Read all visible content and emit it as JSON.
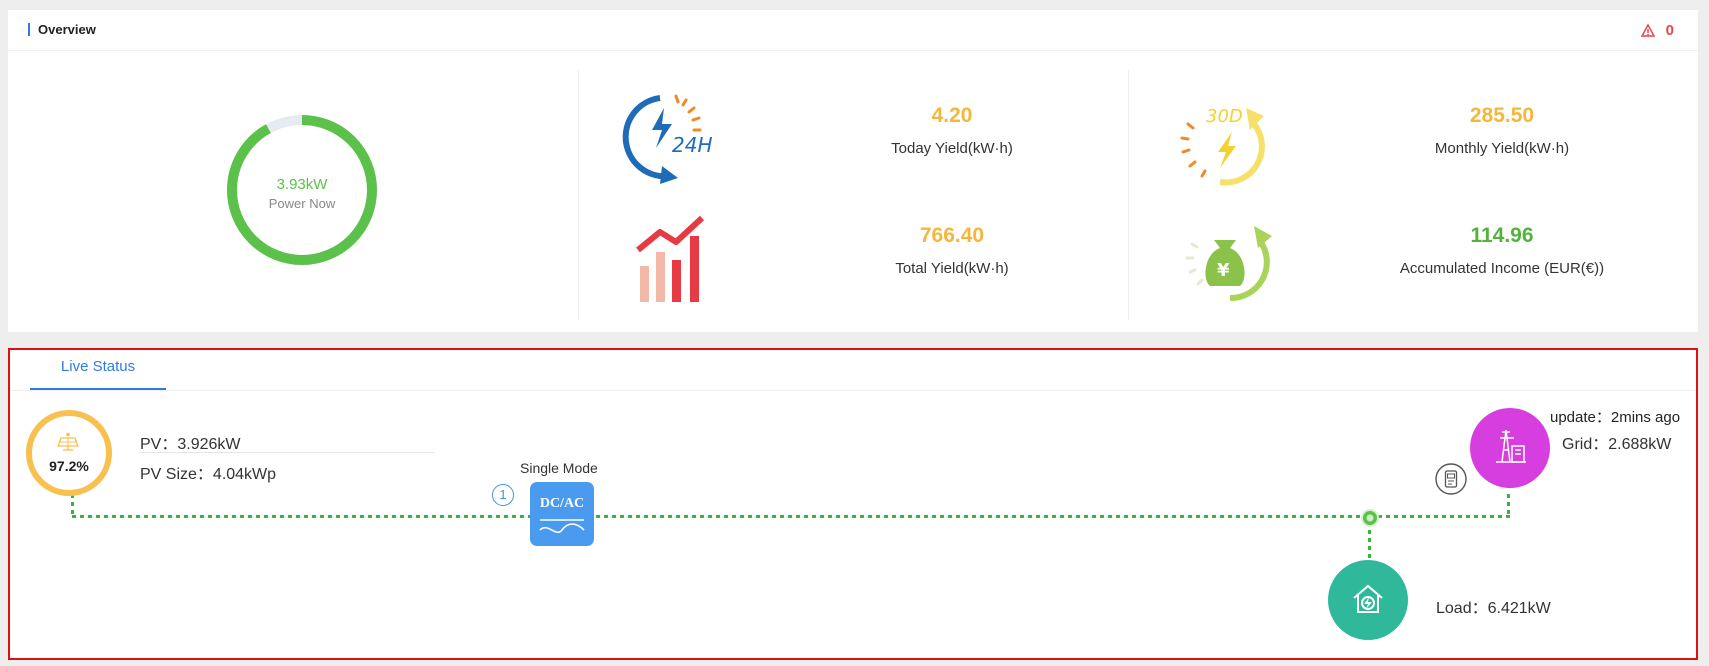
{
  "overview": {
    "title": "Overview",
    "alarm_count": "0",
    "power_now": {
      "value": "3.93kW",
      "label": "Power Now",
      "fraction": 0.92
    },
    "stats": [
      {
        "value": "4.20",
        "label": "Today Yield(kW·h)",
        "color": "#f5b73b"
      },
      {
        "value": "285.50",
        "label": "Monthly Yield(kW·h)",
        "color": "#f5b73b"
      },
      {
        "value": "766.40",
        "label": "Total Yield(kW·h)",
        "color": "#f5b73b"
      },
      {
        "value": "114.96",
        "label": "Accumulated Income (EUR(€))",
        "color": "#52b33c"
      }
    ],
    "icon_24h_text": "24H",
    "icon_30d_text": "30D",
    "icon_yen_text": "¥"
  },
  "live": {
    "tab": "Live Status",
    "pv_percent": "97.2%",
    "pv": "PV：3.926kW",
    "pv_size": "PV Size：4.04kWp",
    "mode": "Single Mode",
    "inverter_count": "1",
    "inverter_label": "DC/AC",
    "update": "update：2mins ago",
    "grid": "Grid：2.688kW",
    "load": "Load：6.421kW"
  },
  "colors": {
    "accent": "#2f7be5",
    "green": "#5cc14a",
    "yellow": "#f5b73b",
    "pink": "#d63ee0",
    "teal": "#2fb89a"
  }
}
